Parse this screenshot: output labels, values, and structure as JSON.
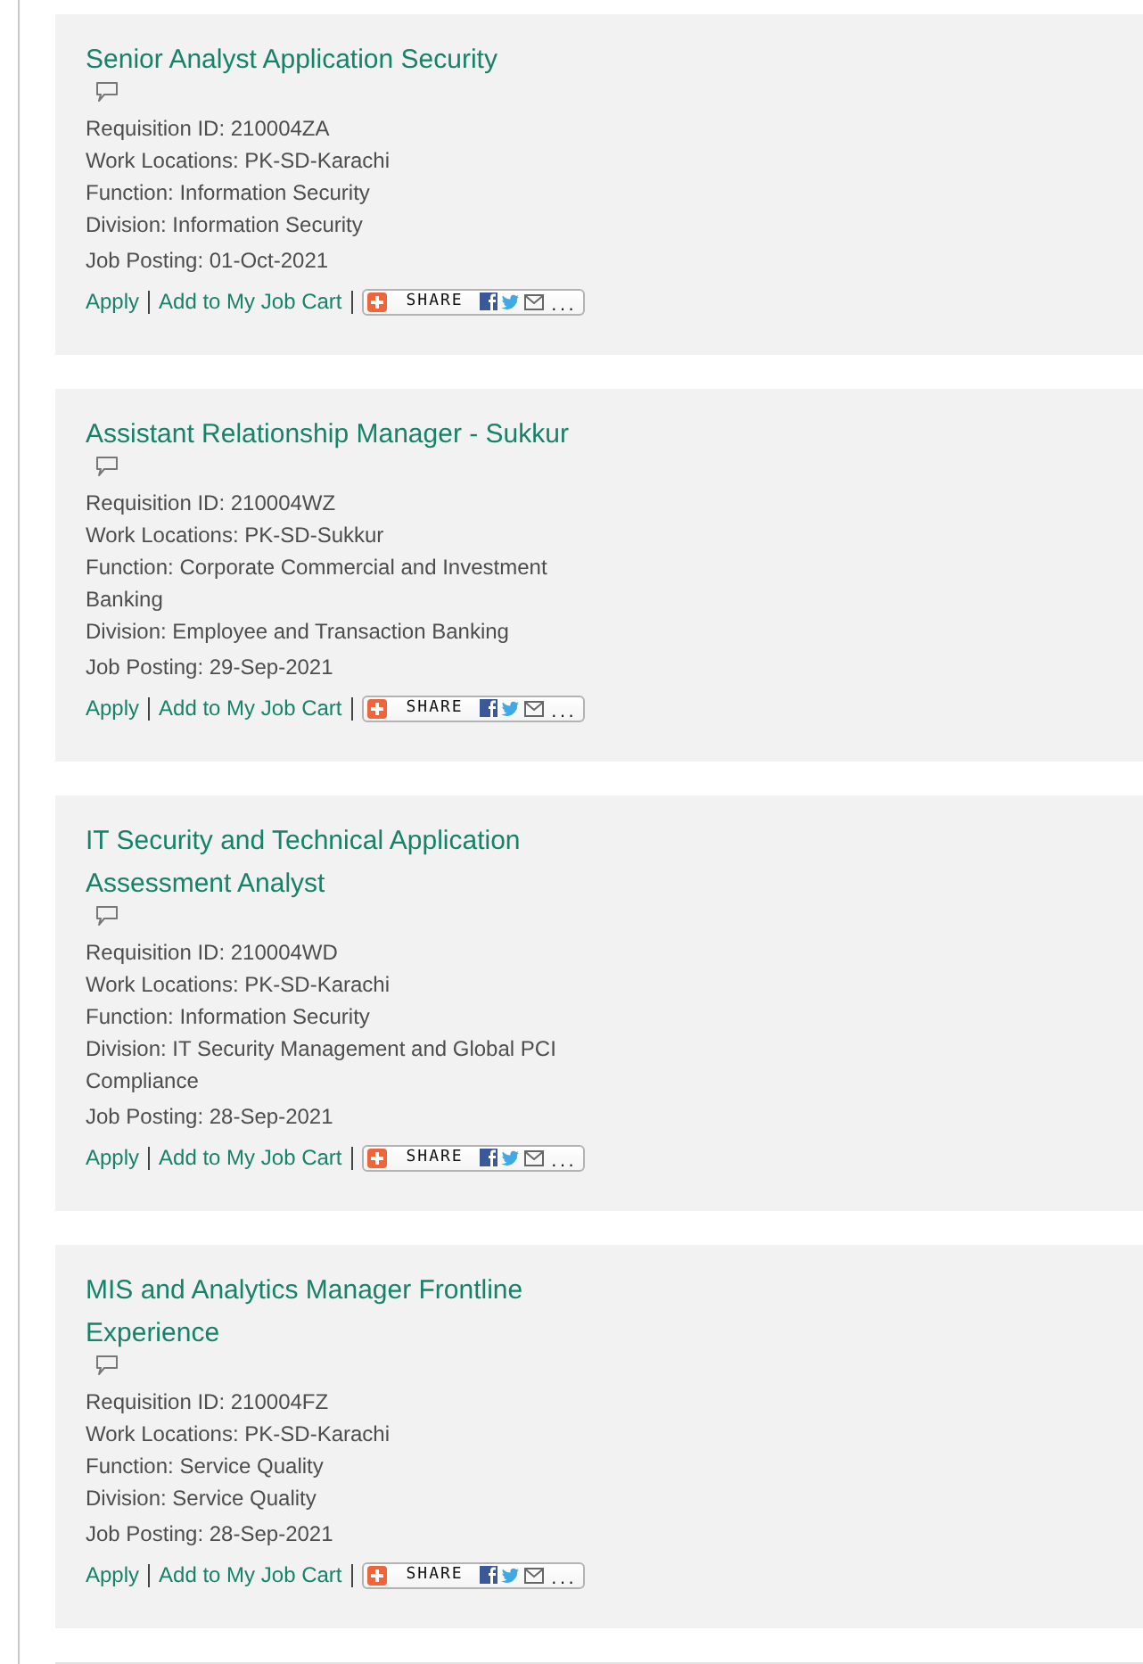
{
  "jobs": [
    {
      "title": "Senior Analyst Application Security",
      "details": [
        "Requisition ID: 210004ZA",
        "Work Locations: PK-SD-Karachi",
        "Function: Information Security",
        "Division: Information Security"
      ],
      "posting": "Job Posting: 01-Oct-2021",
      "links": [
        "Apply",
        "Add to My Job Cart"
      ],
      "share": {
        "label": "SHARE",
        "more": "..."
      }
    },
    {
      "title": "Assistant Relationship Manager - Sukkur",
      "details": [
        "Requisition ID: 210004WZ",
        "Work Locations: PK-SD-Sukkur",
        "Function: Corporate Commercial and Investment Banking",
        "Division: Employee and Transaction Banking"
      ],
      "posting": "Job Posting: 29-Sep-2021",
      "links": [
        "Apply",
        "Add to My Job Cart"
      ],
      "share": {
        "label": "SHARE",
        "more": "..."
      }
    },
    {
      "title": "IT Security and Technical Application Assessment Analyst",
      "details": [
        "Requisition ID: 210004WD",
        "Work Locations: PK-SD-Karachi",
        "Function: Information Security",
        "Division: IT Security Management and Global PCI Compliance"
      ],
      "posting": "Job Posting: 28-Sep-2021",
      "links": [
        "Apply",
        "Add to My Job Cart"
      ],
      "share": {
        "label": "SHARE",
        "more": "..."
      }
    },
    {
      "title": "MIS and Analytics Manager Frontline Experience",
      "details": [
        "Requisition ID: 210004FZ",
        "Work Locations: PK-SD-Karachi",
        "Function: Service Quality",
        "Division: Service Quality"
      ],
      "posting": "Job Posting: 28-Sep-2021",
      "links": [
        "Apply",
        "Add to My Job Cart"
      ],
      "share": {
        "label": "SHARE",
        "more": "..."
      }
    }
  ]
}
